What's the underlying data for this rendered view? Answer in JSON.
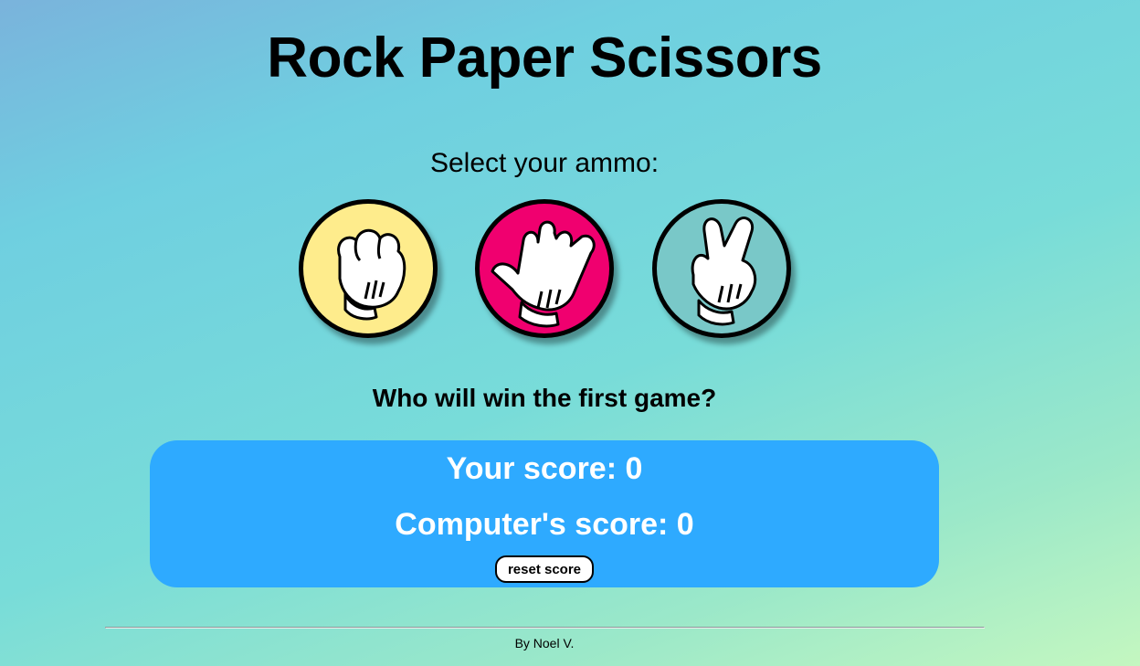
{
  "page": {
    "title": "Rock Paper Scissors",
    "prompt": "Select your ammo:",
    "status": "Who will win the first game?",
    "footer": "By Noel V."
  },
  "choices": [
    {
      "id": "rock",
      "icon": "rock-hand-icon",
      "color": "#feec8c"
    },
    {
      "id": "paper",
      "icon": "paper-hand-icon",
      "color": "#f0006f"
    },
    {
      "id": "scissors",
      "icon": "scissors-hand-icon",
      "color": "#79c8c8"
    }
  ],
  "scoreboard": {
    "player_label": "Your score: 0",
    "computer_label": "Computer's score: 0",
    "reset_label": "reset score",
    "background": "#2eaaff"
  }
}
